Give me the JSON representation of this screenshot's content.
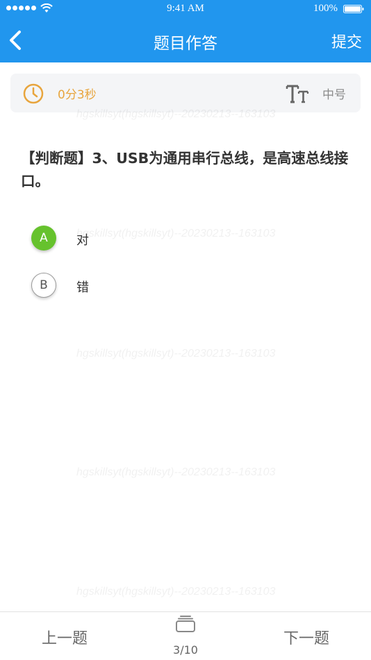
{
  "status_bar": {
    "time": "9:41 AM",
    "battery": "100%",
    "icons": [
      "signal-dots-icon",
      "wifi-icon",
      "battery-icon"
    ]
  },
  "nav": {
    "title": "题目作答",
    "submit_label": "提交",
    "back_icon": "chevron-left-icon"
  },
  "toolbar": {
    "timer": "0分3秒",
    "timer_icon": "clock-icon",
    "font_icon": "font-size-icon",
    "font_size_label": "中号"
  },
  "question": {
    "text": "【判断题】3、USB为通用串行总线，是高速总线接口。",
    "options": [
      {
        "letter": "A",
        "text": "对",
        "selected": true
      },
      {
        "letter": "B",
        "text": "错",
        "selected": false
      }
    ]
  },
  "watermark": "hgskillsyt(hgskillsyt)--20230213--163103",
  "footer": {
    "prev_label": "上一题",
    "next_label": "下一题",
    "progress": "3/10",
    "card_icon": "answer-card-icon"
  },
  "colors": {
    "primary": "#2196ee",
    "accent_orange": "#e8a53d",
    "selected_green": "#66c22d"
  }
}
